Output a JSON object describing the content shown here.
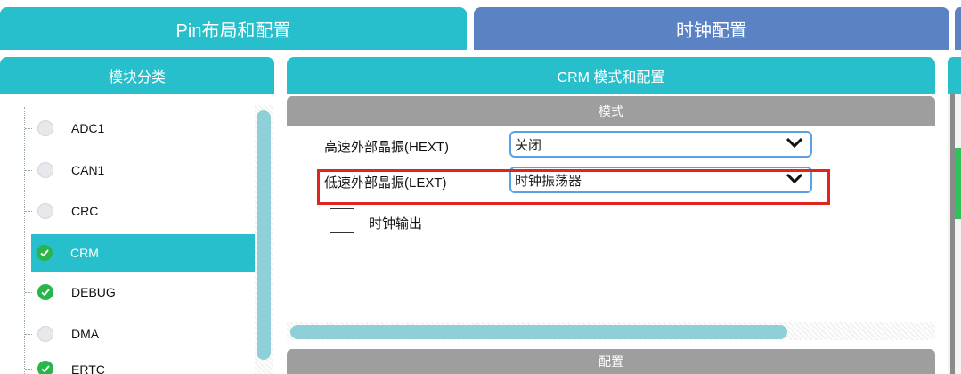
{
  "tabs": {
    "pin_layout": "Pin布局和配置",
    "clock_config": "时钟配置"
  },
  "left_panel": {
    "title": "模块分类",
    "items": [
      {
        "label": "ADC1",
        "status": "gray"
      },
      {
        "label": "CAN1",
        "status": "gray"
      },
      {
        "label": "CRC",
        "status": "gray"
      },
      {
        "label": "CRM",
        "status": "green",
        "selected": true
      },
      {
        "label": "DEBUG",
        "status": "green"
      },
      {
        "label": "DMA",
        "status": "gray"
      },
      {
        "label": "ERTC",
        "status": "green"
      }
    ]
  },
  "center_panel": {
    "title": "CRM 模式和配置",
    "mode_section": "模式",
    "hext_label": "高速外部晶振(HEXT)",
    "hext_value": "关闭",
    "lext_label": "低速外部晶振(LEXT)",
    "lext_value": "时钟振荡器",
    "clock_output_label": "时钟输出",
    "config_section": "配置"
  },
  "colors": {
    "accent_teal": "#27bfcb",
    "tab_blue": "#5b82c3",
    "section_gray": "#9e9e9e",
    "ok_green": "#28b54a",
    "highlight_red": "#e3231d"
  }
}
